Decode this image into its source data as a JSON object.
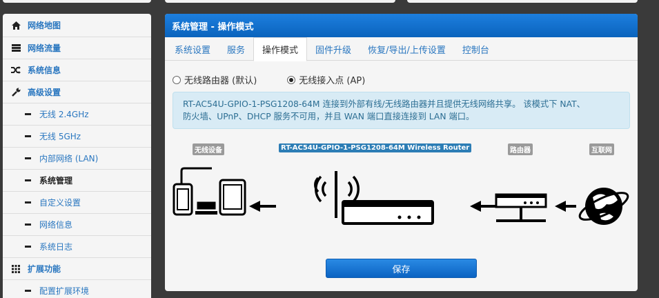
{
  "sidebar": {
    "items": [
      {
        "label": "网络地图",
        "icon": "home-icon"
      },
      {
        "label": "网络流量",
        "icon": "traffic-icon"
      },
      {
        "label": "系统信息",
        "icon": "shuffle-icon"
      },
      {
        "label": "高级设置",
        "icon": "wrench-icon"
      }
    ],
    "sub_items": [
      {
        "label": "无线 2.4GHz"
      },
      {
        "label": "无线 5GHz"
      },
      {
        "label": "内部网络 (LAN)"
      },
      {
        "label": "系统管理"
      },
      {
        "label": "自定义设置"
      },
      {
        "label": "网络信息"
      },
      {
        "label": "系统日志"
      }
    ],
    "extensions": {
      "label": "扩展功能",
      "icon": "grid-icon"
    },
    "ext_sub": {
      "label": "配置扩展环境"
    }
  },
  "panel": {
    "title": "系统管理 - 操作模式",
    "tabs": [
      "系统设置",
      "服务",
      "操作模式",
      "固件升级",
      "恢复/导出/上传设置",
      "控制台"
    ],
    "active_tab": "操作模式"
  },
  "mode": {
    "option1": "无线路由器 (默认)",
    "option2": "无线接入点 (AP)",
    "selected": "option2"
  },
  "info": {
    "line1": "RT-AC54U-GPIO-1-PSG1208-64M 连接到外部有线/无线路由器并且提供无线网络共享。 该模式下 NAT、",
    "line2": "防火墙、UPnP、DHCP 服务不可用，并且 WAN 端口直接连接到 LAN 端口。"
  },
  "diagram": {
    "wireless_devices": "无线设备",
    "router_label": "RT-AC54U-GPIO-1-PSG1208-64M Wireless Router",
    "upstream_router": "路由器",
    "internet": "互联网"
  },
  "save_label": "保存",
  "colors": {
    "accent": "#0a6fd0",
    "link": "#2a77c0",
    "info_bg": "#d8ebf5"
  }
}
